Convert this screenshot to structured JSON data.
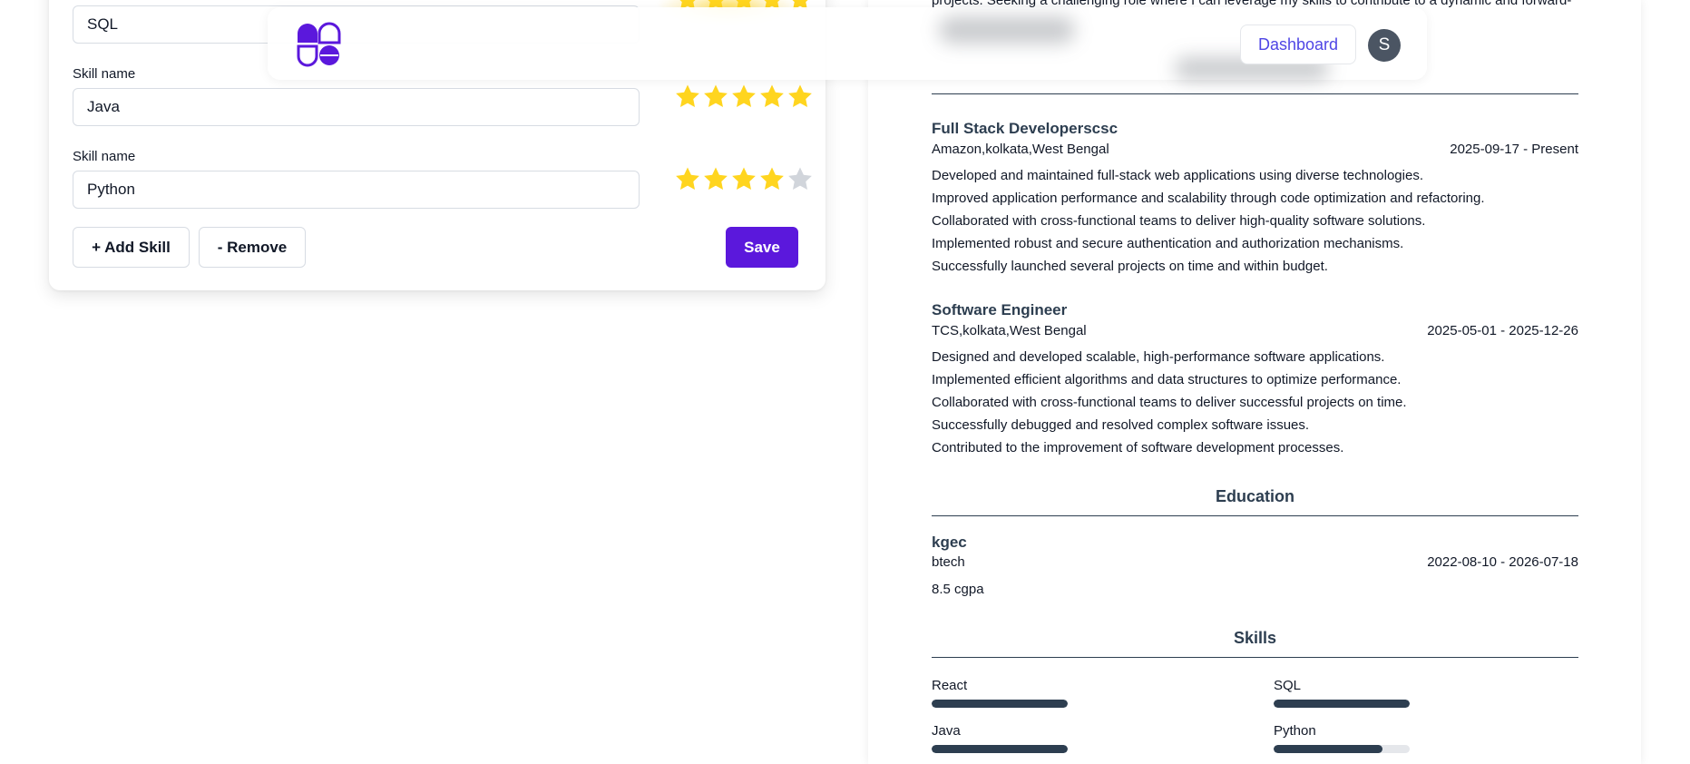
{
  "header": {
    "dashboard_label": "Dashboard",
    "avatar_initial": "S",
    "brand_color": "#5b18dc"
  },
  "skills_editor": {
    "skill_label": "Skill name",
    "rows": [
      {
        "value": "SQL",
        "rating": 5,
        "max": 5
      },
      {
        "value": "Java",
        "rating": 5,
        "max": 5
      },
      {
        "value": "Python",
        "rating": 4,
        "max": 5
      }
    ],
    "add_label": "+ Add Skill",
    "remove_label": "- Remove",
    "save_label": "Save"
  },
  "resume": {
    "summary_tail": "projects. Seeking a challenging role where I can leverage my skills to contribute to a dynamic and forward-",
    "experience": [
      {
        "title": "Full Stack Developerscsc",
        "company": "Amazon,kolkata,West Bengal",
        "dates": "2025-09-17 - Present",
        "bullets": [
          "Developed and maintained full-stack web applications using diverse technologies.",
          "Improved application performance and scalability through code optimization and refactoring.",
          "Collaborated with cross-functional teams to deliver high-quality software solutions.",
          "Implemented robust and secure authentication and authorization mechanisms.",
          "Successfully launched several projects on time and within budget."
        ]
      },
      {
        "title": "Software Engineer",
        "company": "TCS,kolkata,West Bengal",
        "dates": "2025-05-01 - 2025-12-26",
        "bullets": [
          "Designed and developed scalable, high-performance software applications.",
          "Implemented efficient algorithms and data structures to optimize performance.",
          "Collaborated with cross-functional teams to deliver successful projects on time.",
          "Successfully debugged and resolved complex software issues.",
          "Contributed to the improvement of software development processes."
        ]
      }
    ],
    "education_title": "Education",
    "education": {
      "school": "kgec",
      "degree": "btech",
      "dates": "2022-08-10 - 2026-07-18",
      "grade": "8.5 cgpa"
    },
    "skills_title": "Skills",
    "skills": [
      {
        "name": "React",
        "level": 1.0
      },
      {
        "name": "SQL",
        "level": 1.0
      },
      {
        "name": "Java",
        "level": 1.0
      },
      {
        "name": "Python",
        "level": 0.8
      }
    ]
  }
}
